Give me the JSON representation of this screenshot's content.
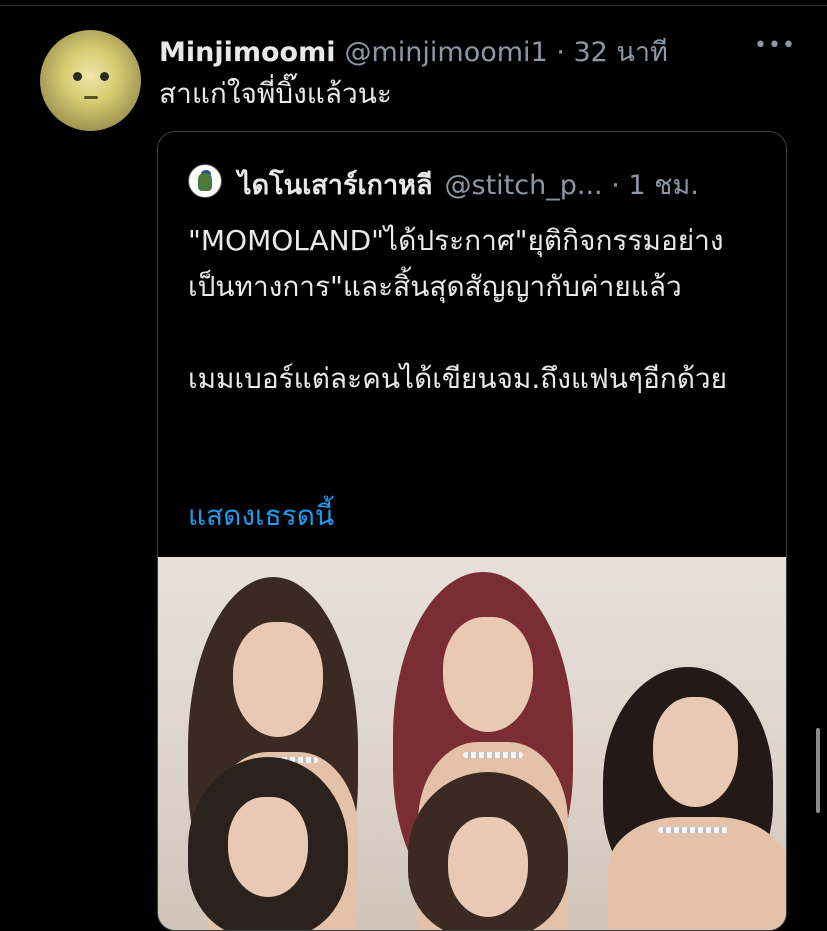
{
  "tweet": {
    "display_name": "Minjimoomi",
    "handle_time": "@minjimoomi1 · 32 นาที",
    "text": "สาแก่ใจพี่บิ๊งแล้วนะ",
    "more_icon": "•••"
  },
  "quoted_tweet": {
    "display_name": "ไดโนเสาร์เกาหลี",
    "handle_time": "@stitch_p... · 1 ชม.",
    "paragraph_1": "\"MOMOLAND\"ได้ประกาศ\"ยุติกิจกรรมอย่างเป็นทางการ\"และสิ้นสุดสัญญากับค่ายแล้ว",
    "paragraph_2": "เมมเบอร์แต่ละคนได้เขียนจม.ถึงแฟนๆอีกด้วย",
    "show_thread": "แสดงเธรดนี้"
  },
  "colors": {
    "background": "#000000",
    "text": "#e7e9ea",
    "secondary": "#8b98a5",
    "link": "#1d9bf0"
  }
}
